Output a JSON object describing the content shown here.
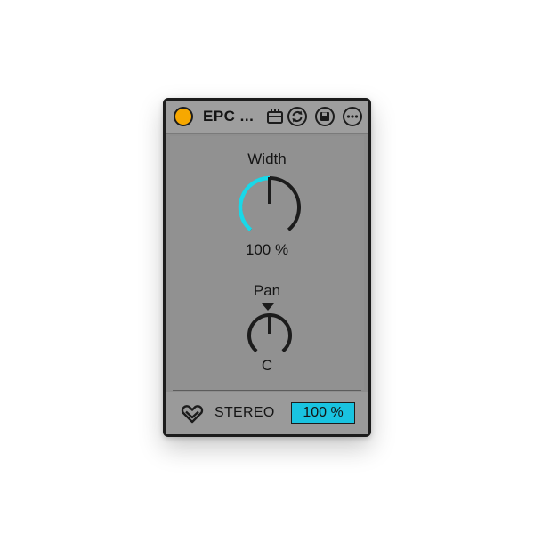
{
  "device": {
    "title": "EPC ...",
    "power_on": true,
    "power_color": "#f7a800",
    "toolbar_icons": [
      "midi-map-icon",
      "hot-swap-icon",
      "save-preset-icon",
      "more-options-icon"
    ]
  },
  "width_control": {
    "label": "Width",
    "value_text": "100 %",
    "value_fraction": 0.5,
    "accent_color": "#19d8e8"
  },
  "pan_control": {
    "label": "Pan",
    "value_text": "C",
    "value_fraction": 0.5
  },
  "footer": {
    "logo_icon": "heart-logo-icon",
    "label": "STEREO",
    "readout": "100 %",
    "readout_color": "#19c3e0"
  }
}
